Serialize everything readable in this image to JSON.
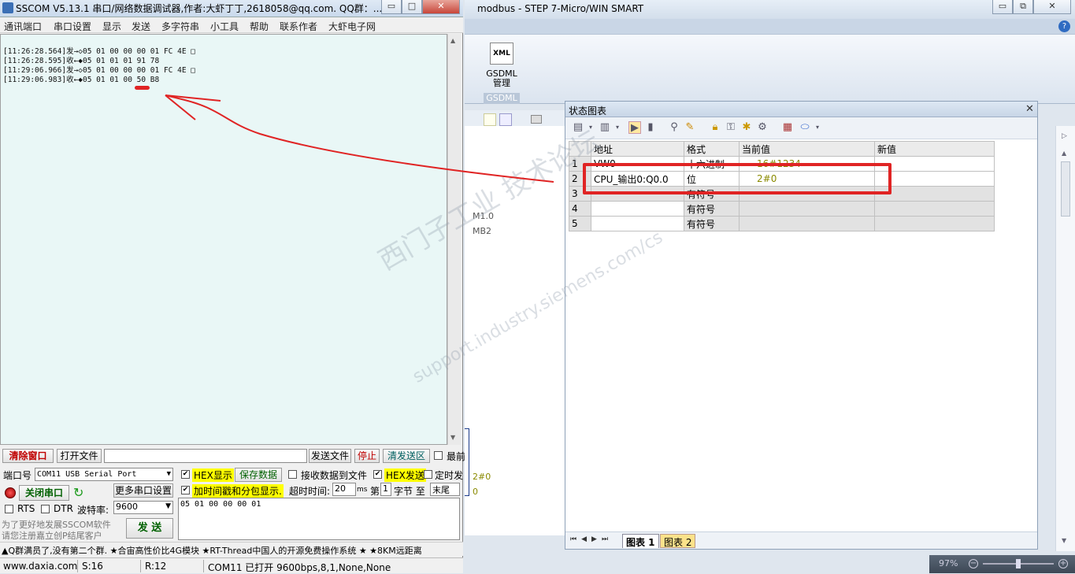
{
  "sscom": {
    "title": "SSCOM V5.13.1 串口/网络数据调试器,作者:大虾丁丁,2618058@qq.com. QQ群：...",
    "menu": [
      "通讯端口",
      "串口设置",
      "显示",
      "发送",
      "多字符串",
      "小工具",
      "帮助",
      "联系作者",
      "大虾电子网"
    ],
    "recv_lines": [
      "[11:26:28.564]发→◇05 01 00 00 00 01 FC 4E □",
      "[11:26:28.595]收←◆05 01 01 01 91 78",
      "[11:29:06.966]发→◇05 01 00 00 00 01 FC 4E □",
      "[11:29:06.983]收←◆05 01 01 00 50 B8"
    ],
    "row1": {
      "clear": "清除窗口",
      "open_file": "打开文件",
      "send_file": "发送文件",
      "stop": "停止",
      "clear_send": "清发送区",
      "top": "最前"
    },
    "port_label": "端口号",
    "port_value": "COM11 USB Serial Port",
    "hex_display": "HEX显示",
    "save_data": "保存数据",
    "recv_to_file": "接收数据到文件",
    "hex_send": "HEX发送",
    "timed_send": "定时发",
    "close_port": "关闭串口",
    "more_settings": "更多串口设置",
    "timestamp_label": "加时间戳和分包显示.",
    "timeout_label": "超时时间:",
    "timeout_value": "20",
    "timeout_unit": "ms",
    "byte_label1": "第",
    "byte_value": "1",
    "byte_label2": "字节 至",
    "byte_end": "末尾",
    "rts": "RTS",
    "dtr": "DTR",
    "baud_label": "波特率:",
    "baud_value": "9600",
    "send_text": "05 01 00 00 00 01",
    "promo": [
      "为了更好地发展SSCOM软件",
      "请您注册嘉立创P结尾客户"
    ],
    "send_button": "发 送",
    "ticker": "▲Q群满员了,没有第二个群. ★合宙高性价比4G模块 ★RT-Thread中国人的开源免费操作系统 ★ ★8KM远距离",
    "status": {
      "site": "www.daxia.com",
      "s": "S:16",
      "r": "R:12",
      "port": "COM11 已打开  9600bps,8,1,None,None"
    }
  },
  "step7": {
    "title": "modbus - STEP 7-Micro/WIN SMART",
    "gsdml_label": "GSDML\n管理",
    "gsdml_group": "GSDML",
    "side_labels": [
      "M1.0",
      "MB2",
      "2#0",
      "0"
    ],
    "zoom": "97%"
  },
  "panel": {
    "title": "状态图表",
    "headers": [
      "地址",
      "格式",
      "当前值",
      "新值"
    ],
    "rows": [
      {
        "n": "1",
        "addr": "VW0",
        "fmt": "十六进制",
        "cur": "16#1234",
        "new": ""
      },
      {
        "n": "2",
        "addr": "CPU_输出0:Q0.0",
        "fmt": "位",
        "cur": "2#0",
        "new": ""
      },
      {
        "n": "3",
        "addr": "",
        "fmt": "有符号",
        "cur": "",
        "new": ""
      },
      {
        "n": "4",
        "addr": "",
        "fmt": "有符号",
        "cur": "",
        "new": ""
      },
      {
        "n": "5",
        "addr": "",
        "fmt": "有符号",
        "cur": "",
        "new": ""
      }
    ],
    "tabs": [
      "图表 1",
      "图表 2"
    ]
  },
  "watermark": {
    "line1": "西门子工业 技术论坛",
    "line2": "support.industry.siemens.com/cs"
  },
  "colors": {
    "annotation": "#e02424",
    "recv_bg": "#e9f7f6",
    "value_text": "#8a8a00"
  }
}
